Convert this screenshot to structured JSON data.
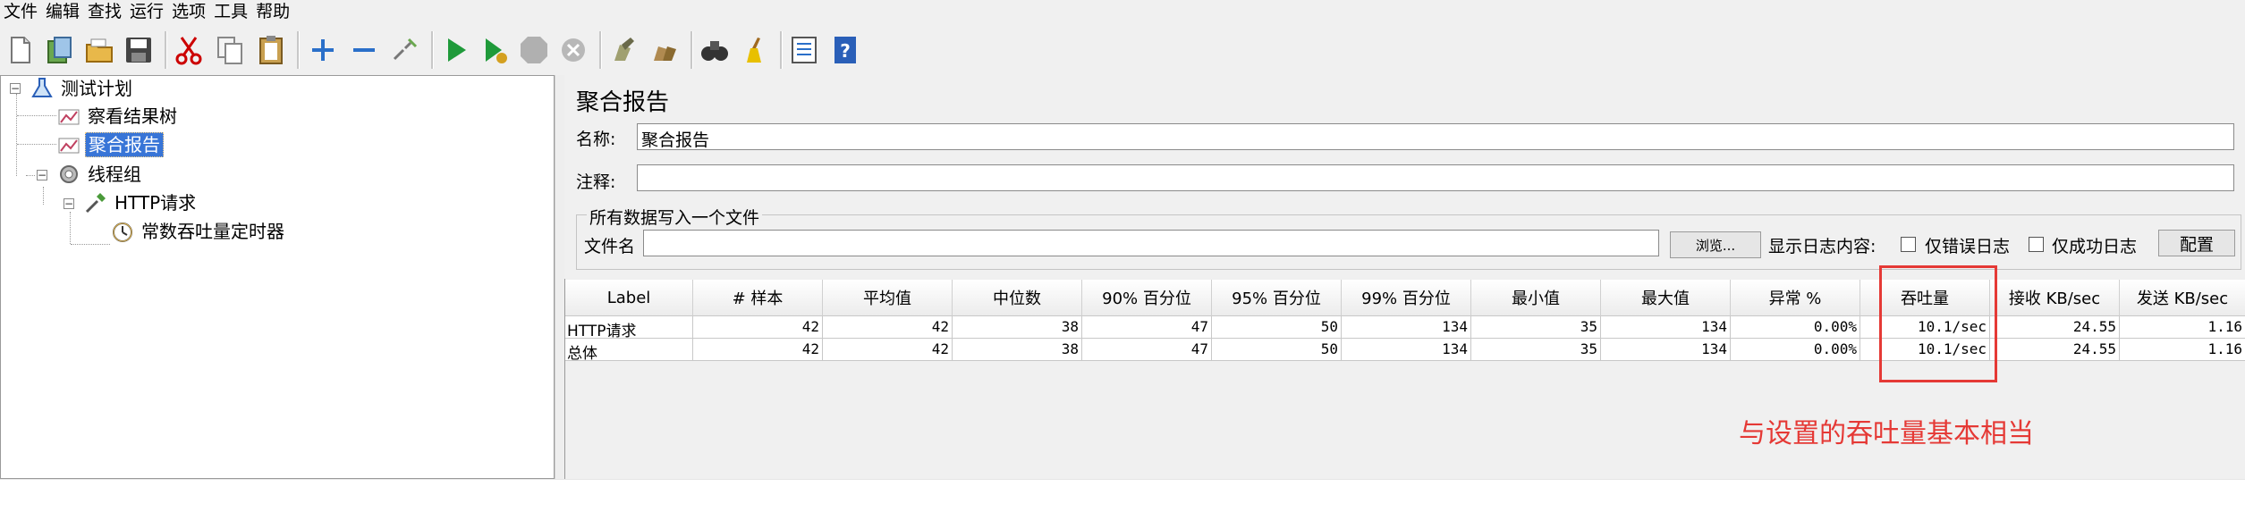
{
  "menu": [
    "文件",
    "编辑",
    "查找",
    "运行",
    "选项",
    "工具",
    "帮助"
  ],
  "toolbar_icons": [
    "new-icon",
    "templates-icon",
    "open-icon",
    "save-icon",
    "cut-icon",
    "copy-icon",
    "paste-icon",
    "expand-icon",
    "collapse-icon",
    "toggle-icon",
    "start-icon",
    "start-no-pause-icon",
    "stop-icon",
    "shutdown-icon",
    "clear-icon",
    "clear-all-icon",
    "search-icon",
    "reset-search-icon",
    "function-helper-icon",
    "help-icon"
  ],
  "tree": {
    "root": "测试计划",
    "view_results_tree": "察看结果树",
    "aggregate_report": "聚合报告",
    "thread_group": "线程组",
    "http_request": "HTTP请求",
    "timer": "常数吞吐量定时器"
  },
  "panel": {
    "title": "聚合报告",
    "name_label": "名称:",
    "name_value": "聚合报告",
    "comment_label": "注释:",
    "comment_value": "",
    "group_title": "所有数据写入一个文件",
    "filename_label": "文件名",
    "filename_value": "",
    "browse_button": "浏览...",
    "log_label": "显示日志内容:",
    "errors_only": "仅错误日志",
    "success_only": "仅成功日志",
    "configure_button": "配置"
  },
  "table": {
    "headers": [
      "Label",
      "# 样本",
      "平均值",
      "中位数",
      "90% 百分位",
      "95% 百分位",
      "99% 百分位",
      "最小值",
      "最大值",
      "异常 %",
      "吞吐量",
      "接收 KB/sec",
      "发送 KB/sec"
    ],
    "rows": [
      [
        "HTTP请求",
        "42",
        "42",
        "38",
        "47",
        "50",
        "134",
        "35",
        "134",
        "0.00%",
        "10.1/sec",
        "24.55",
        "1.16"
      ],
      [
        "总体",
        "42",
        "42",
        "38",
        "47",
        "50",
        "134",
        "35",
        "134",
        "0.00%",
        "10.1/sec",
        "24.55",
        "1.16"
      ]
    ]
  },
  "annotation": "与设置的吞吐量基本相当",
  "colors": {
    "highlight": "#e53935",
    "selection": "#3875d7"
  }
}
